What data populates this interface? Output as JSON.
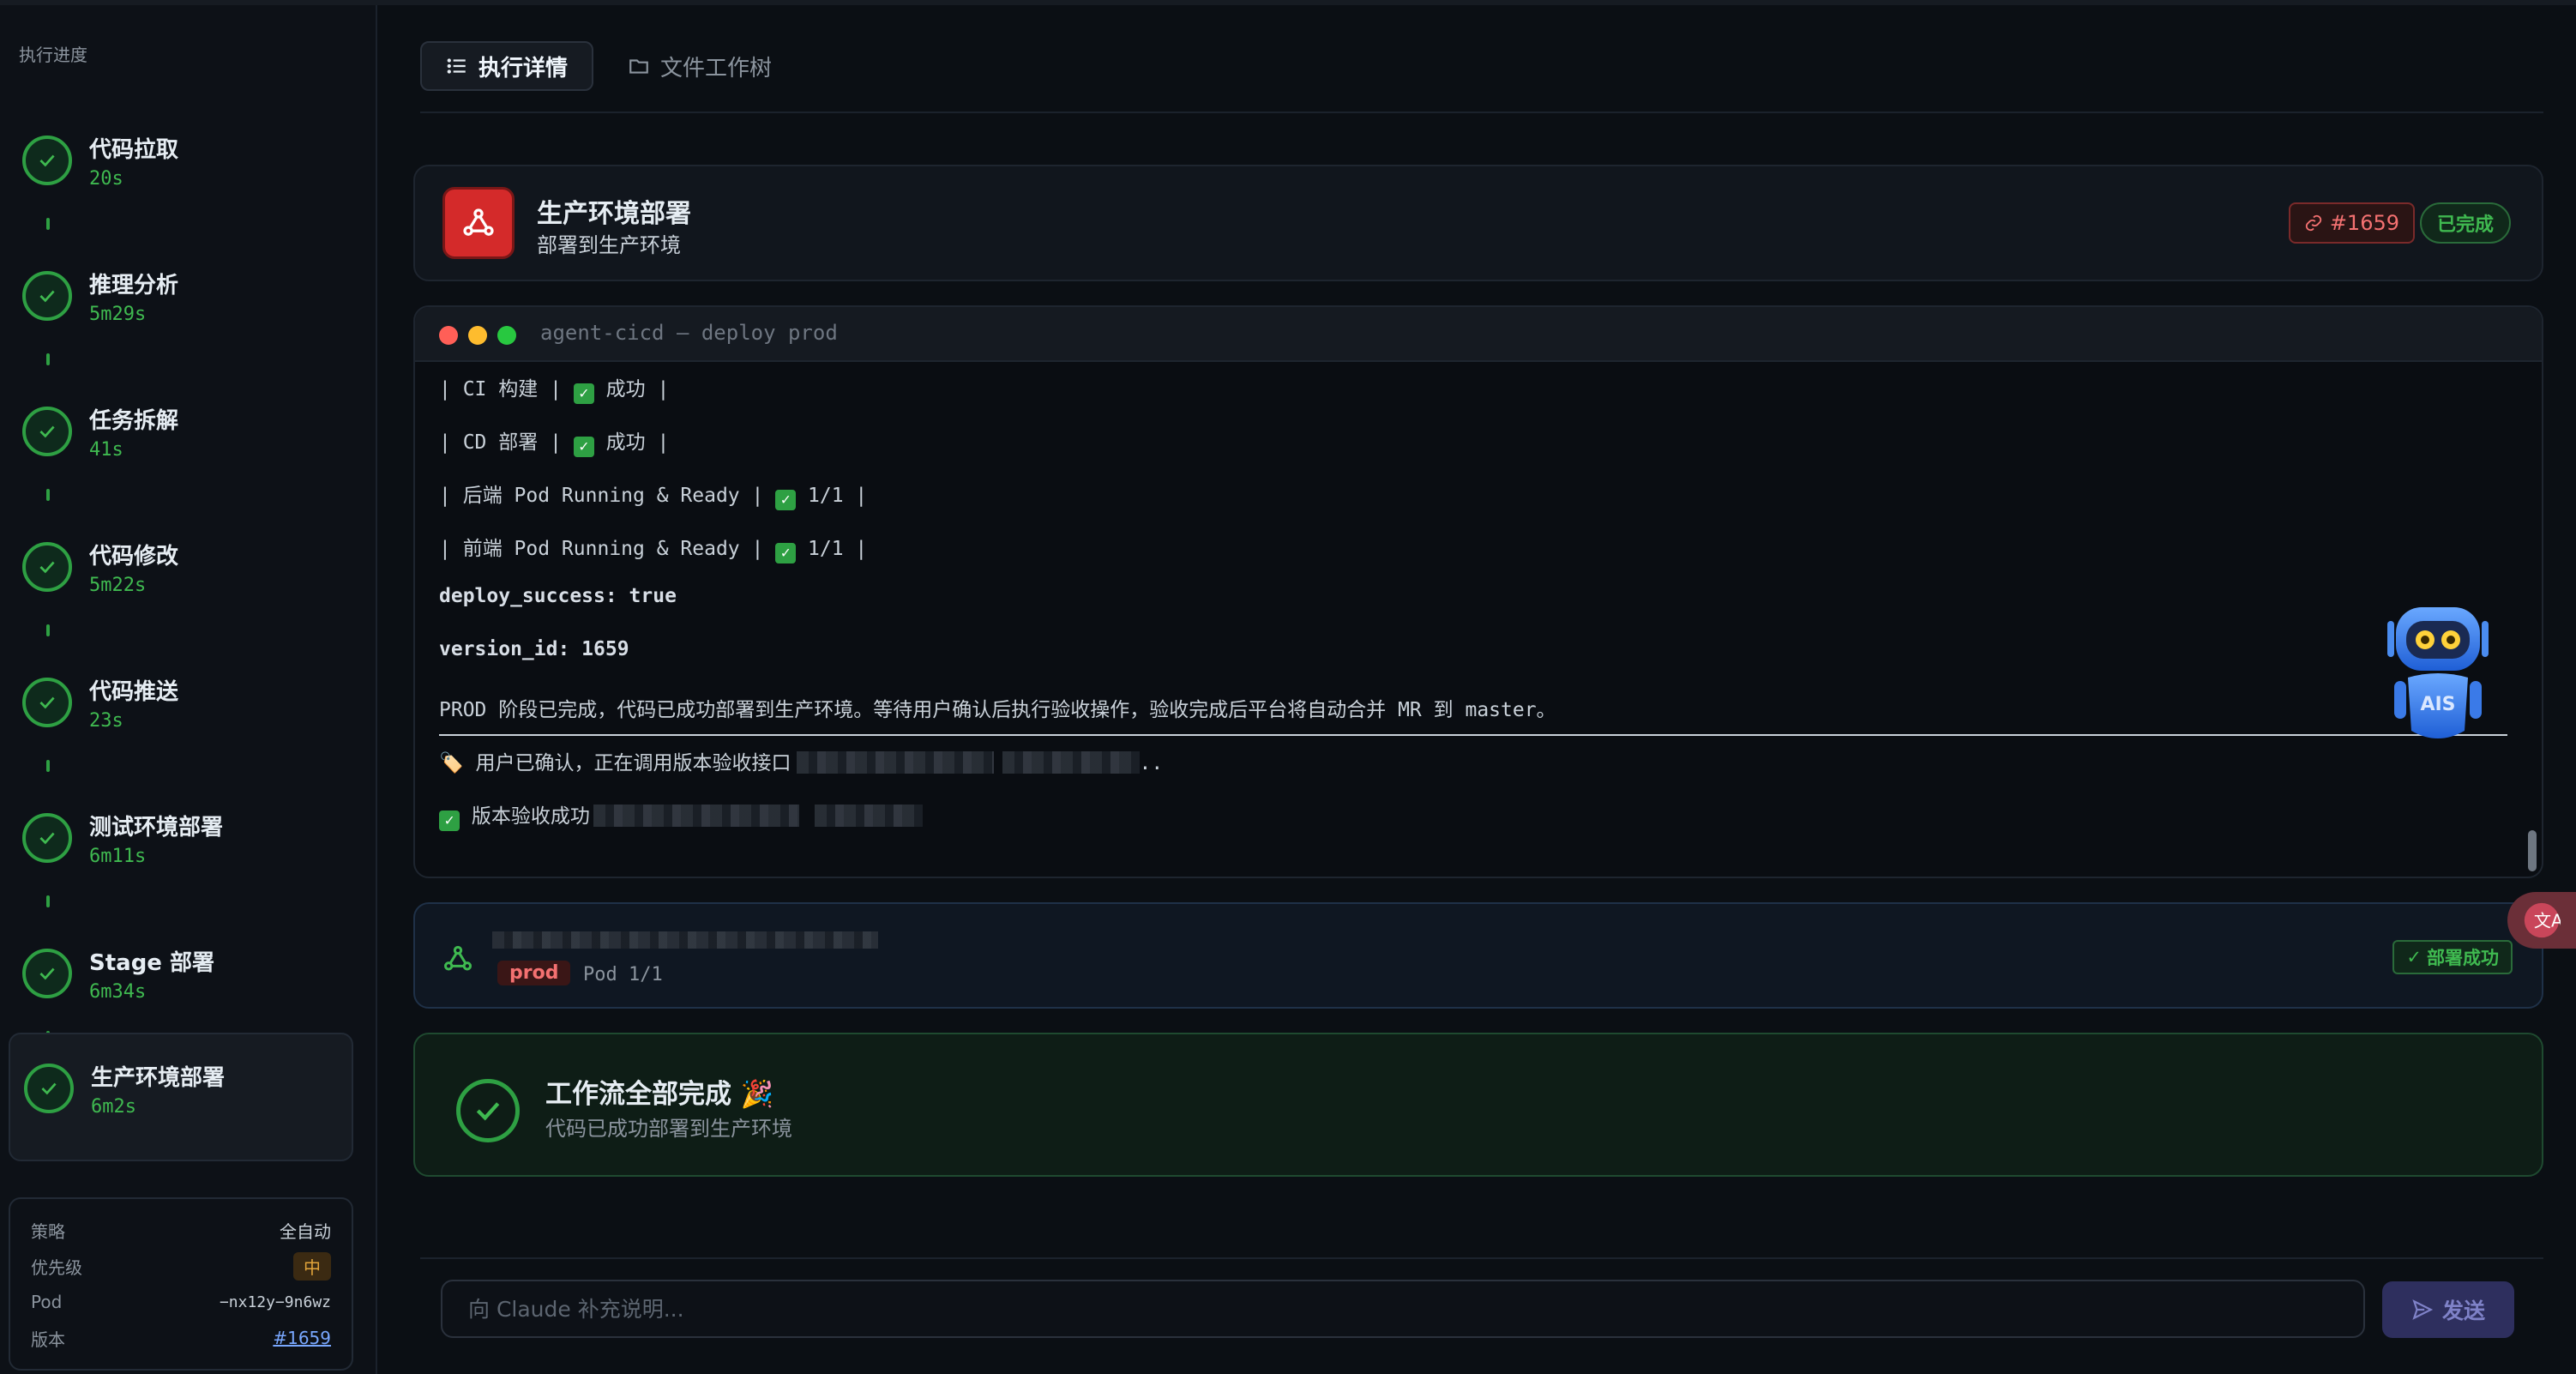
{
  "sidebar": {
    "title": "执行进度",
    "steps": [
      {
        "name": "代码拉取",
        "time": "20s"
      },
      {
        "name": "推理分析",
        "time": "5m29s"
      },
      {
        "name": "任务拆解",
        "time": "41s"
      },
      {
        "name": "代码修改",
        "time": "5m22s"
      },
      {
        "name": "代码推送",
        "time": "23s"
      },
      {
        "name": "测试环境部署",
        "time": "6m11s"
      },
      {
        "name": "Stage 部署",
        "time": "6m34s"
      },
      {
        "name": "生产环境部署",
        "time": "6m2s"
      }
    ],
    "meta": {
      "strategy_label": "策略",
      "strategy_value": "全自动",
      "priority_label": "优先级",
      "priority_value": "中",
      "pod_label": "Pod",
      "pod_value": "−nx12y−9n6wz",
      "version_label": "版本",
      "version_value": "#1659"
    }
  },
  "tabs": {
    "details": "执行详情",
    "filetree": "文件工作树"
  },
  "header": {
    "title": "生产环境部署",
    "subtitle": "部署到生产环境",
    "version_badge": "#1659",
    "status_badge": "已完成"
  },
  "terminal": {
    "title": "agent-cicd — deploy prod",
    "lines": [
      {
        "pre": "| CI 构建 | ",
        "post": " 成功 |"
      },
      {
        "pre": "| CD 部署 | ",
        "post": " 成功 |"
      },
      {
        "pre": "| 后端 Pod Running & Ready | ",
        "post": " 1/1 |"
      },
      {
        "pre": "| 前端 Pod Running & Ready | ",
        "post": " 1/1 |"
      }
    ],
    "deploy_success": "deploy_success: true",
    "version_id": "version_id: 1659",
    "summary": "PROD 阶段已完成，代码已成功部署到生产环境。等待用户确认后执行验收操作，验收完成后平台将自动合并 MR 到 master。",
    "confirm_line": "用户已确认，正在调用版本验收接口",
    "confirm_tail": "..",
    "accept_line": "版本验收成功"
  },
  "deploy": {
    "env_tag": "prod",
    "pod": "Pod 1/1",
    "status": "部署成功"
  },
  "done": {
    "title": "工作流全部完成 🎉",
    "subtitle": "代码已成功部署到生产环境"
  },
  "input": {
    "placeholder": "向 Claude 补充说明...",
    "send_label": "发送"
  },
  "colors": {
    "success": "#2ea043",
    "danger": "#d42a2a",
    "accent": "#79a8ff"
  }
}
